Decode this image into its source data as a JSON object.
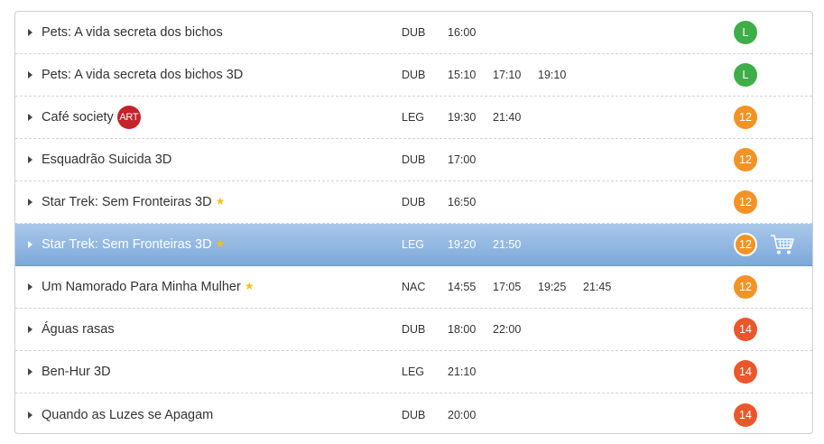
{
  "colors": {
    "rating_L": "#3fae49",
    "rating_12": "#f39325",
    "rating_14": "#e9582c",
    "art_badge": "#c3232b",
    "star": "#f5c21a",
    "selected_row_top": "#a9c8ea",
    "selected_row_bottom": "#7da8da"
  },
  "icons": {
    "row_toggle": "triangle-right-icon",
    "featured": "star-icon",
    "cart": "shopping-cart-icon"
  },
  "sessions": [
    {
      "title": "Pets: A vida secreta dos bichos",
      "lang": "DUB",
      "times": [
        "16:00"
      ],
      "rating": "L",
      "featured": false,
      "art": ""
    },
    {
      "title": "Pets: A vida secreta dos bichos 3D",
      "lang": "DUB",
      "times": [
        "15:10",
        "17:10",
        "19:10"
      ],
      "rating": "L",
      "featured": false,
      "art": ""
    },
    {
      "title": "Café society",
      "lang": "LEG",
      "times": [
        "19:30",
        "21:40"
      ],
      "rating": "12",
      "featured": false,
      "art": "ART"
    },
    {
      "title": "Esquadrão Suicida 3D",
      "lang": "DUB",
      "times": [
        "17:00"
      ],
      "rating": "12",
      "featured": false,
      "art": ""
    },
    {
      "title": "Star Trek: Sem Fronteiras 3D",
      "lang": "DUB",
      "times": [
        "16:50"
      ],
      "rating": "12",
      "featured": true,
      "art": ""
    },
    {
      "title": "Star Trek: Sem Fronteiras 3D",
      "lang": "LEG",
      "times": [
        "19:20",
        "21:50"
      ],
      "rating": "12",
      "featured": true,
      "art": "",
      "selected": true
    },
    {
      "title": "Um Namorado Para Minha Mulher",
      "lang": "NAC",
      "times": [
        "14:55",
        "17:05",
        "19:25",
        "21:45"
      ],
      "rating": "12",
      "featured": true,
      "art": ""
    },
    {
      "title": "Águas rasas",
      "lang": "DUB",
      "times": [
        "18:00",
        "22:00"
      ],
      "rating": "14",
      "featured": false,
      "art": ""
    },
    {
      "title": "Ben-Hur 3D",
      "lang": "LEG",
      "times": [
        "21:10"
      ],
      "rating": "14",
      "featured": false,
      "art": ""
    },
    {
      "title": "Quando as Luzes se Apagam",
      "lang": "DUB",
      "times": [
        "20:00"
      ],
      "rating": "14",
      "featured": false,
      "art": ""
    }
  ]
}
